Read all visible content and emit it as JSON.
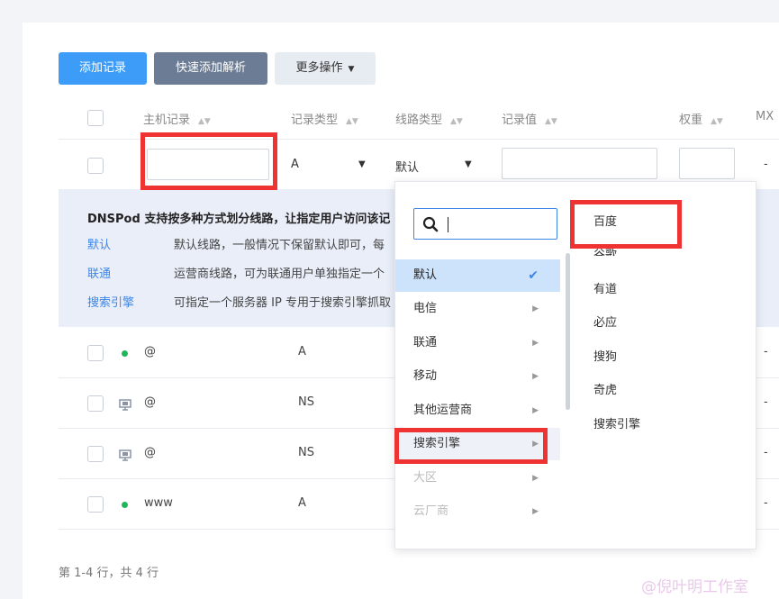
{
  "toolbar": {
    "add_label": "添加记录",
    "quick_label": "快速添加解析",
    "more_label": "更多操作",
    "more_caret": "▼"
  },
  "table": {
    "headers": [
      "主机记录",
      "记录类型",
      "线路类型",
      "记录值",
      "权重",
      "MX"
    ],
    "sort_glyph": "▲▼",
    "edit_row": {
      "record_type": "A",
      "line_type": "默认",
      "caret": "▼",
      "dash": "-"
    },
    "rows": [
      {
        "host": "@",
        "type": "A",
        "status": "enabled",
        "dash": "-"
      },
      {
        "host": "@",
        "type": "NS",
        "status": "monitor",
        "dash": "-"
      },
      {
        "host": "@",
        "type": "NS",
        "status": "monitor",
        "dash": "-"
      },
      {
        "host": "www",
        "type": "A",
        "status": "enabled",
        "dash": "-"
      }
    ]
  },
  "info": {
    "title": "DNSPod 支持按多种方式划分线路，让指定用户访问该记",
    "items": [
      {
        "name": "默认",
        "desc": "默认线路，一般情况下保留默认即可，每"
      },
      {
        "name": "联通",
        "desc": "运营商线路，可为联通用户单独指定一个"
      },
      {
        "name": "搜索引擎",
        "desc": "可指定一个服务器 IP 专用于搜索引擎抓取"
      }
    ]
  },
  "dropdown": {
    "search_placeholder": "",
    "search_icon": "search-icon",
    "check": "✔",
    "arrow": "▶",
    "menu": [
      {
        "label": "默认",
        "state": "selected"
      },
      {
        "label": "电信",
        "state": "normal"
      },
      {
        "label": "联通",
        "state": "normal"
      },
      {
        "label": "移动",
        "state": "normal"
      },
      {
        "label": "其他运营商",
        "state": "normal"
      },
      {
        "label": "搜索引擎",
        "state": "hover"
      },
      {
        "label": "大区",
        "state": "disabled"
      },
      {
        "label": "云厂商",
        "state": "disabled"
      }
    ],
    "submenu": [
      "百度",
      "谷歌",
      "有道",
      "必应",
      "搜狗",
      "奇虎",
      "搜索引擎"
    ]
  },
  "pager": {
    "text": "第 1-4 行，共 4 行"
  },
  "watermark": "@倪叶明工作室",
  "colors": {
    "primary": "#3d9cf8",
    "highlight": "#ef3333",
    "enabled_dot": "#21b65a",
    "info_bg": "#e9eef9"
  }
}
